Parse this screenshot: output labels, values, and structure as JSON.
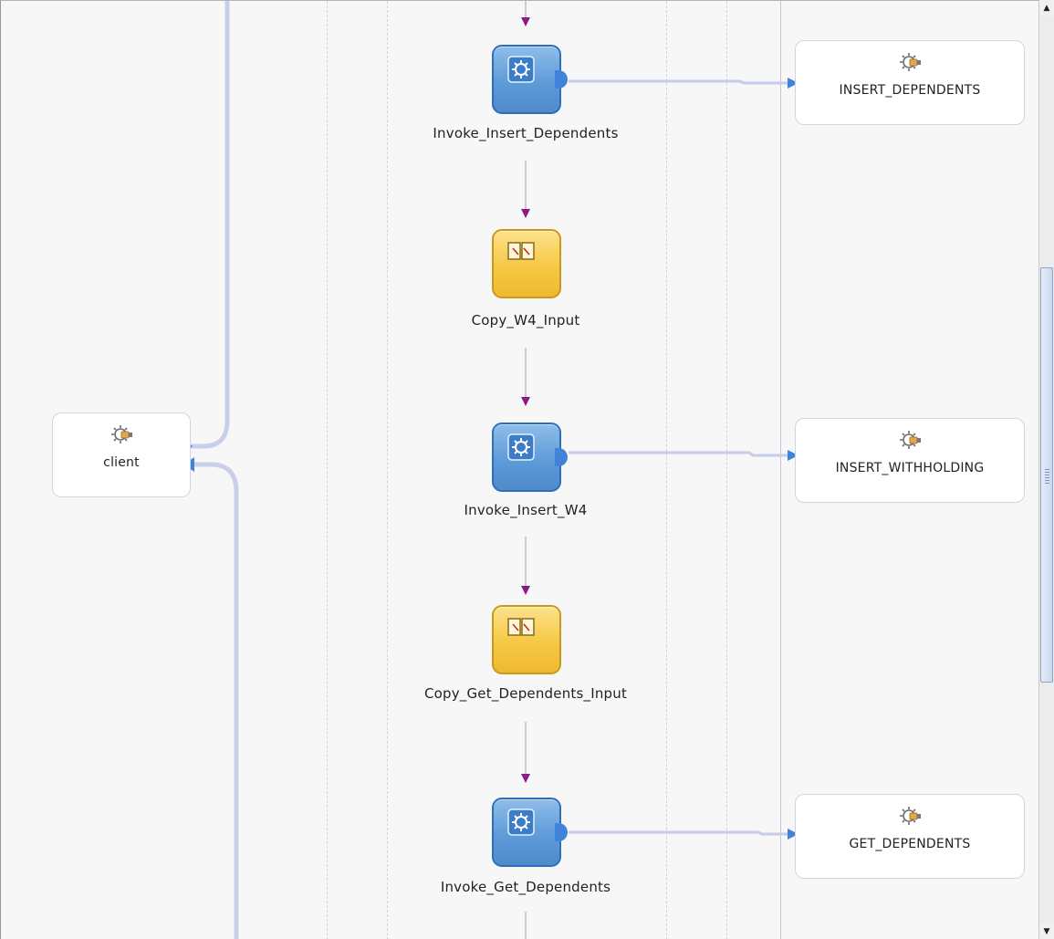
{
  "diagram": {
    "partner_links": [
      {
        "id": "client",
        "label": "client",
        "icon": "gear-service-icon"
      },
      {
        "id": "insert_dependents",
        "label": "INSERT_DEPENDENTS",
        "icon": "gear-service-icon"
      },
      {
        "id": "insert_withholding",
        "label": "INSERT_WITHHOLDING",
        "icon": "gear-service-icon"
      },
      {
        "id": "get_dependents",
        "label": "GET_DEPENDENTS",
        "icon": "gear-service-icon"
      }
    ],
    "activities": [
      {
        "id": "invoke_insert_dependents",
        "label": "Invoke_Insert_Dependents",
        "type": "invoke",
        "icon": "gear-icon"
      },
      {
        "id": "copy_w4_input",
        "label": "Copy_W4_Input",
        "type": "assign",
        "icon": "assign-icon"
      },
      {
        "id": "invoke_insert_w4",
        "label": "Invoke_Insert_W4",
        "type": "invoke",
        "icon": "gear-icon"
      },
      {
        "id": "copy_get_dependents_input",
        "label": "Copy_Get_Dependents_Input",
        "type": "assign",
        "icon": "assign-icon"
      },
      {
        "id": "invoke_get_dependents",
        "label": "Invoke_Get_Dependents",
        "type": "invoke",
        "icon": "gear-icon"
      }
    ],
    "colors": {
      "invoke_fill": "#5e9bd9",
      "assign_fill": "#f6c845",
      "flow_arrow": "#8b1a8b",
      "wire": "#c5cbe8",
      "port": "#3f84d8"
    }
  },
  "scrollbar": {
    "up_arrow": "▲",
    "down_arrow": "▼"
  }
}
